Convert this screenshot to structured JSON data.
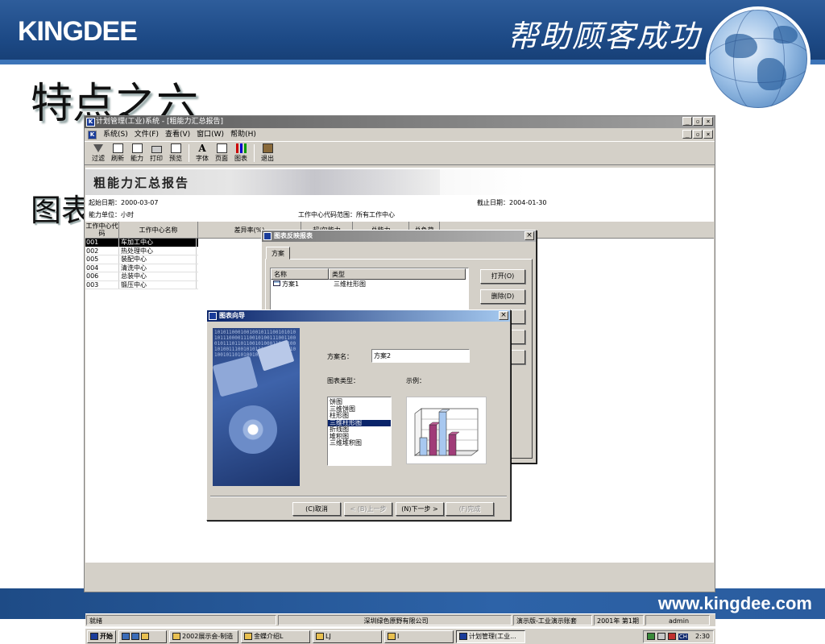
{
  "slide": {
    "logo": "KINGDEE",
    "slogan": "帮助顾客成功",
    "title": "特点之六",
    "subtitle": "图表",
    "website": "www.kingdee.com"
  },
  "window": {
    "title": "计划管理(工业)系统 - [粗能力汇总报告]",
    "menu": [
      "系统(S)",
      "文件(F)",
      "查看(V)",
      "窗口(W)",
      "帮助(H)"
    ],
    "toolbar": [
      "过滤",
      "刷新",
      "能力",
      "打印",
      "预览",
      "字体",
      "页面",
      "图表",
      "退出"
    ]
  },
  "report": {
    "banner_title": "粗能力汇总报告",
    "start_date": "起始日期：2000-03-07",
    "end_date": "截止日期：2004-01-30",
    "unit": "能力单位：小时",
    "code_range": "工作中心代码范围：所有工作中心",
    "columns": [
      "工作中心代码",
      "工作中心名称",
      "差异率(%)",
      "超/欠能力",
      "总能力",
      "总负荷"
    ],
    "rows": [
      {
        "code": "001",
        "name": "车加工中心",
        "selected": true
      },
      {
        "code": "002",
        "name": "热处理中心",
        "selected": false
      },
      {
        "code": "005",
        "name": "装配中心",
        "selected": false
      },
      {
        "code": "004",
        "name": "清洗中心",
        "selected": false
      },
      {
        "code": "006",
        "name": "总装中心",
        "selected": false
      },
      {
        "code": "003",
        "name": "锻压中心",
        "selected": false
      }
    ]
  },
  "dialog_reports": {
    "title": "图表反映报表",
    "tab": "方案",
    "columns": [
      "名称",
      "类型"
    ],
    "rows": [
      {
        "name": "方案1",
        "type": "三维柱形图"
      }
    ],
    "buttons": [
      "打开(O)",
      "删除(D)"
    ]
  },
  "dialog_wizard": {
    "title": "图表向导",
    "scheme_label": "方案名：",
    "scheme_value": "方案2",
    "type_label": "图表类型：",
    "example_label": "示例：",
    "types": [
      "饼图",
      "三维饼图",
      "柱形图",
      "三维柱形图",
      "折线图",
      "堆积图",
      "三维堆积图"
    ],
    "selected_type": "三维柱形图",
    "buttons": {
      "cancel": "(C)取消",
      "prev": "< (B)上一步",
      "next": "(N)下一步 >",
      "finish": "(F)完成"
    },
    "bits": "1010110001001001011100101010101110000111001010011100110001011101101100101000110101001010011100101011100001010110100101101010010111000101101"
  },
  "statusbar": [
    "就绪",
    "深圳绿色原野有限公司",
    "演示版-工业演示账套",
    "2001年 第1期",
    "admin"
  ],
  "taskbar": {
    "start": "开始",
    "items": [
      "2002展示会-制造",
      "金蝶介绍L",
      "LJ",
      "I",
      "计划管理(工业..."
    ],
    "tray_lang": "CH",
    "clock": "2:30"
  },
  "colors": {
    "header_blue": "#1d4a86",
    "title_active": "#0a246a",
    "chart_blue": "#a8c8f0",
    "chart_purple": "#a03c78"
  }
}
